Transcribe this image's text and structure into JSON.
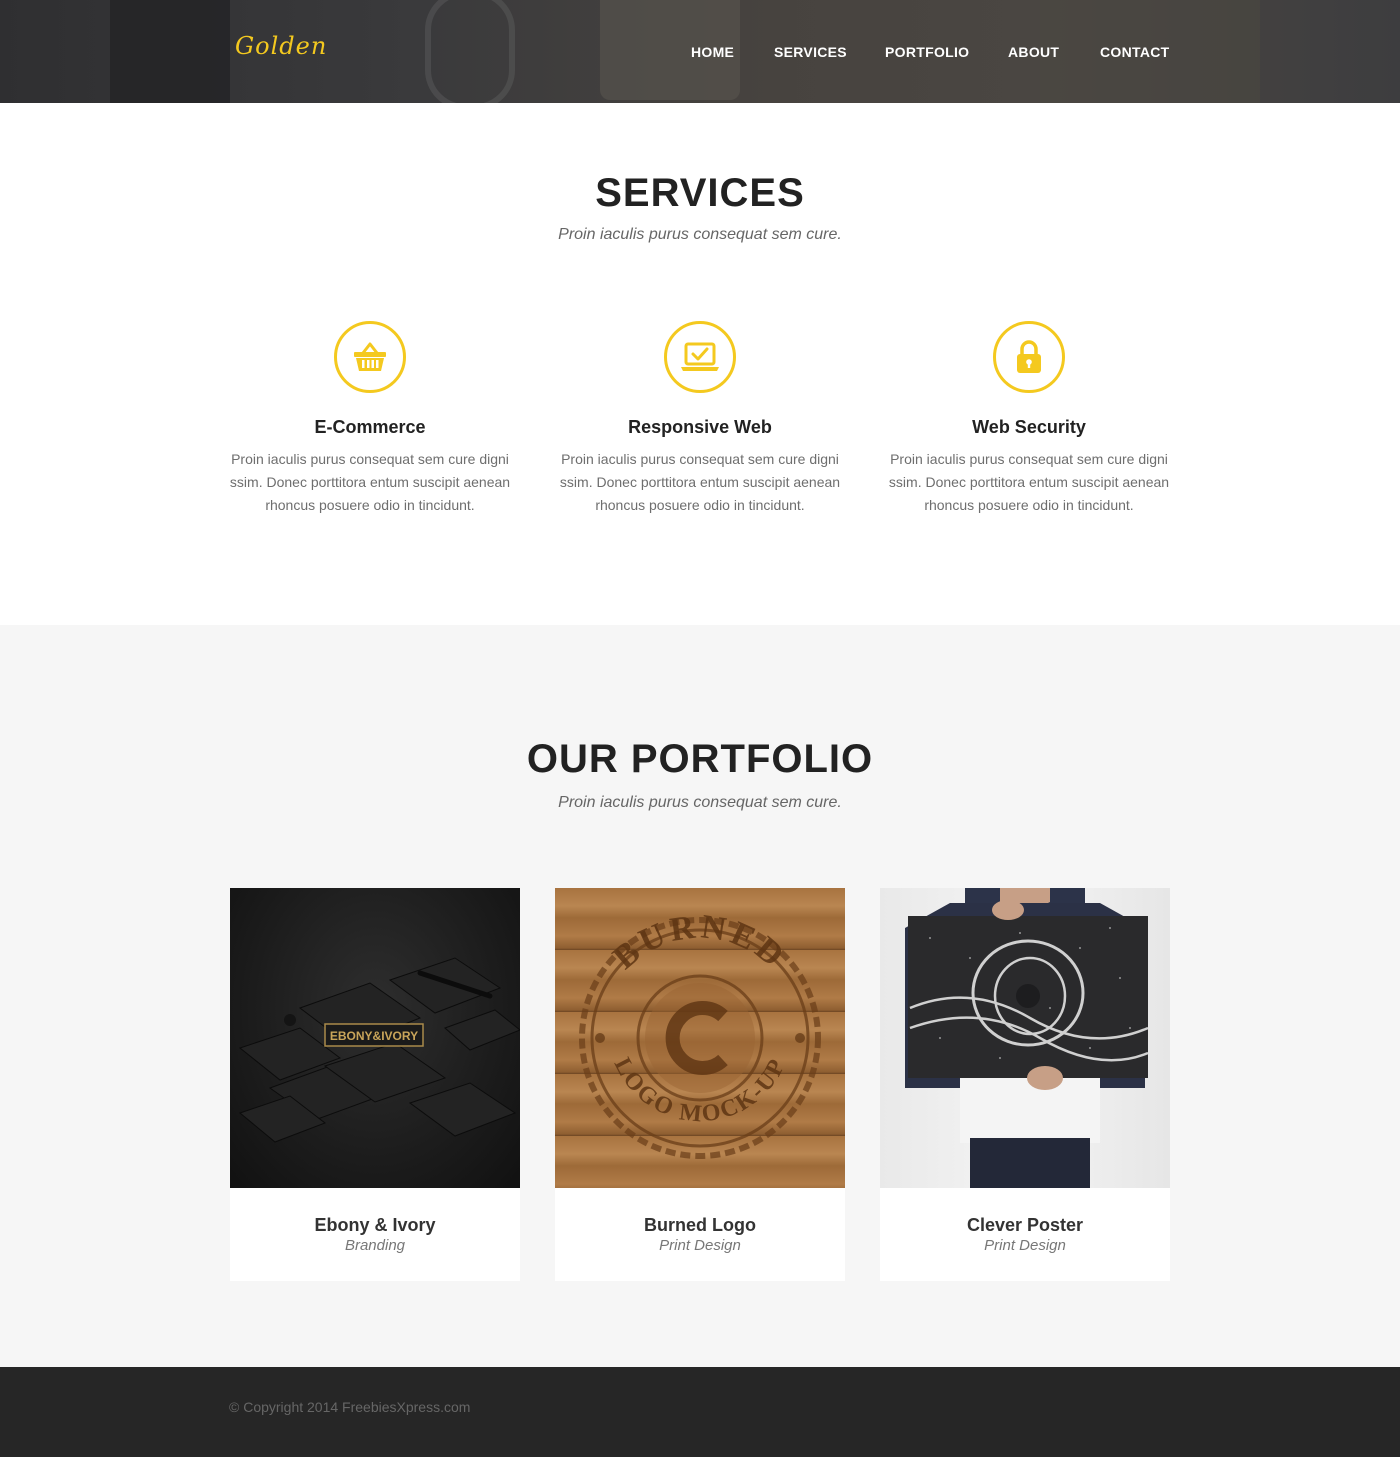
{
  "header": {
    "logo": "Golden",
    "nav": [
      "HOME",
      "SERVICES",
      "PORTFOLIO",
      "ABOUT",
      "CONTACT"
    ]
  },
  "services": {
    "title": "SERVICES",
    "subtitle": "Proin iaculis purus consequat sem cure.",
    "items": [
      {
        "title": "E-Commerce",
        "text": "Proin iaculis purus consequat sem cure digni ssim. Donec porttitora entum suscipit aenean rhoncus posuere odio in tincidunt.",
        "icon": "basket-icon"
      },
      {
        "title": "Responsive Web",
        "text": "Proin iaculis purus consequat sem cure digni ssim. Donec porttitora entum suscipit aenean rhoncus posuere odio in tincidunt.",
        "icon": "laptop-check-icon"
      },
      {
        "title": "Web Security",
        "text": "Proin iaculis purus consequat sem cure digni ssim. Donec porttitora entum suscipit aenean rhoncus posuere odio in tincidunt.",
        "icon": "lock-icon"
      }
    ]
  },
  "portfolio": {
    "title": "OUR PORTFOLIO",
    "subtitle": "Proin iaculis purus consequat sem cure.",
    "items": [
      {
        "title": "Ebony & Ivory",
        "category": "Branding",
        "thumb_text": "EBONY&IVORY"
      },
      {
        "title": "Burned Logo",
        "category": "Print Design",
        "thumb_text_top": "BURNED",
        "thumb_text_bottom": "LOGO MOCK-UP"
      },
      {
        "title": "Clever Poster",
        "category": "Print Design"
      }
    ]
  },
  "footer": {
    "copyright": "© Copyright 2014 FreebiesXpress.com"
  },
  "colors": {
    "accent": "#f4c91f",
    "header_bg": "#3a3a3c",
    "portfolio_bg": "#f6f6f6",
    "footer_bg": "#262626"
  }
}
